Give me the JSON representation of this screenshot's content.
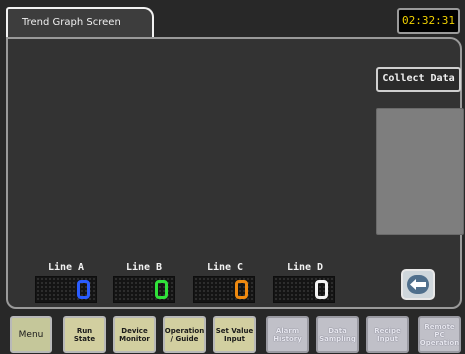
{
  "header": {
    "title": "Trend Graph Screen",
    "clock": "02:32:31"
  },
  "actions": {
    "collect_data": "Collect Data",
    "return_icon": "return-arrow-icon"
  },
  "lines": [
    {
      "label": "Line A",
      "value": "0",
      "color": "#2a5cff"
    },
    {
      "label": "Line B",
      "value": "0",
      "color": "#30e23a"
    },
    {
      "label": "Line C",
      "value": "0",
      "color": "#f08a10"
    },
    {
      "label": "Line D",
      "value": "0",
      "color": "#f4f4f4"
    }
  ],
  "nav": [
    {
      "label": "Menu"
    },
    {
      "label": "Run\nState"
    },
    {
      "label": "Device\nMonitor"
    },
    {
      "label": "Operation\n/ Guide"
    },
    {
      "label": "Set Value\nInput"
    },
    {
      "label": "Alarm\nHistory"
    },
    {
      "label": "Data\nSampling"
    },
    {
      "label": "Recipe\nInput"
    },
    {
      "label": "Remote\nPC\nOperation"
    }
  ]
}
